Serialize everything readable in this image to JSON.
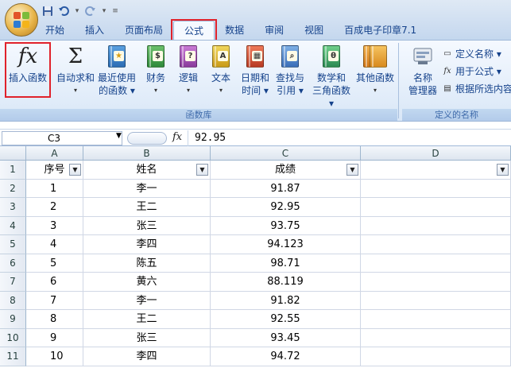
{
  "qat": {
    "save_icon": "save-icon",
    "undo_icon": "undo-icon",
    "redo_icon": "redo-icon",
    "customize_icon": "customize-qat-icon"
  },
  "tabs": [
    {
      "label": "开始"
    },
    {
      "label": "插入"
    },
    {
      "label": "页面布局"
    },
    {
      "label": "公式",
      "active": true
    },
    {
      "label": "数据"
    },
    {
      "label": "审阅"
    },
    {
      "label": "视图"
    },
    {
      "label": "百成电子印章7.1"
    }
  ],
  "ribbon": {
    "function_library": {
      "caption": "函数库",
      "buttons": [
        {
          "line1": "插入函数",
          "line2": "",
          "icon": "fx-icon"
        },
        {
          "line1": "自动求和",
          "line2": "▾",
          "icon": "sigma-icon"
        },
        {
          "line1": "最近使用",
          "line2": "的函数 ▾",
          "icon": "recent-functions-icon"
        },
        {
          "line1": "财务",
          "line2": "▾",
          "icon": "financial-icon"
        },
        {
          "line1": "逻辑",
          "line2": "▾",
          "icon": "logical-icon"
        },
        {
          "line1": "文本",
          "line2": "▾",
          "icon": "text-functions-icon"
        },
        {
          "line1": "日期和",
          "line2": "时间 ▾",
          "icon": "date-time-icon"
        },
        {
          "line1": "查找与",
          "line2": "引用 ▾",
          "icon": "lookup-reference-icon"
        },
        {
          "line1": "数学和",
          "line2": "三角函数 ▾",
          "icon": "math-trig-icon"
        },
        {
          "line1": "其他函数",
          "line2": "▾",
          "icon": "more-functions-icon"
        }
      ]
    },
    "defined_names": {
      "caption": "定义的名称",
      "name_manager_line1": "名称",
      "name_manager_line2": "管理器",
      "define_name": "定义名称 ▾",
      "use_in_formula": "用于公式 ▾",
      "create_from_selection": "根据所选内容"
    }
  },
  "formula_bar": {
    "name_box": "C3",
    "fx": "fx",
    "value": "92.95"
  },
  "sheet": {
    "columns": [
      "A",
      "B",
      "C",
      "D"
    ],
    "row_numbers": [
      "1",
      "2",
      "3",
      "4",
      "5",
      "6",
      "7",
      "8",
      "9",
      "10",
      "11"
    ],
    "headers": [
      "序号",
      "姓名",
      "成绩",
      ""
    ],
    "rows": [
      [
        "1",
        "李一",
        "91.87"
      ],
      [
        "2",
        "王二",
        "92.95"
      ],
      [
        "3",
        "张三",
        "93.75"
      ],
      [
        "4",
        "李四",
        "94.123"
      ],
      [
        "5",
        "陈五",
        "98.71"
      ],
      [
        "6",
        "黄六",
        "88.119"
      ],
      [
        "7",
        "李一",
        "91.82"
      ],
      [
        "8",
        "王二",
        "92.55"
      ],
      [
        "9",
        "张三",
        "93.45"
      ],
      [
        "10",
        "李四",
        "94.72"
      ]
    ]
  }
}
